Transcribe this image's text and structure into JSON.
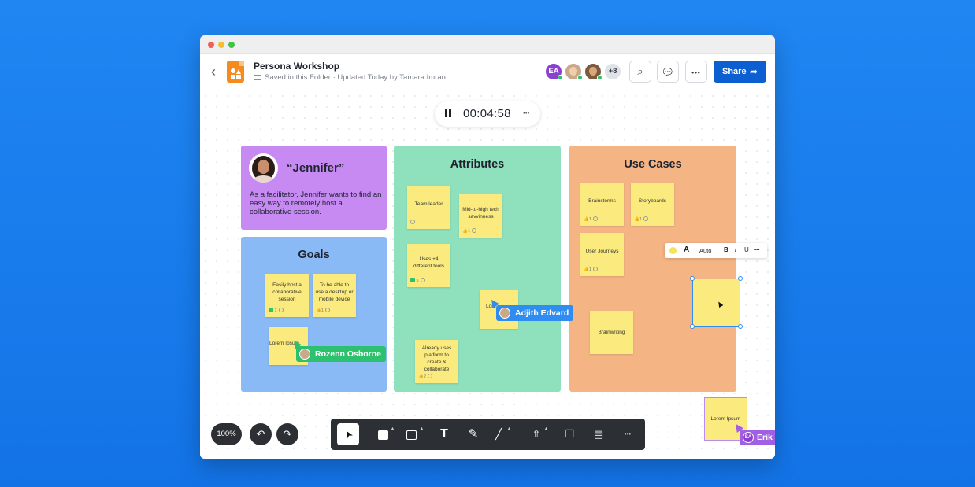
{
  "window": {
    "back_icon": "chevron-left-icon",
    "doc_title": "Persona Workshop",
    "doc_location": "Saved in this Folder",
    "doc_separator": "·",
    "doc_updated": "Updated Today by Tamara Imran"
  },
  "collaborators": {
    "first_initials": "EA",
    "more_count": "+8"
  },
  "header_buttons": {
    "search_icon": "⌕",
    "comment_icon": "💬",
    "more_icon": "•••",
    "share_label": "Share",
    "share_icon": "➦"
  },
  "timer": {
    "time": "00:04:58",
    "more": "•••"
  },
  "persona": {
    "name": "“Jennifer”",
    "description": "As a facilitator, Jennifer wants to find an easy way to remotely host a collaborative session."
  },
  "goals": {
    "title": "Goals",
    "stickies": [
      {
        "text": "Easily host a collaborative session",
        "meta": "1"
      },
      {
        "text": "To be able to use a desktop or mobile device",
        "meta": "1"
      },
      {
        "text": "Lorem Ipsum",
        "meta": ""
      }
    ]
  },
  "attributes": {
    "title": "Attributes",
    "stickies": [
      {
        "text": "Team leader",
        "meta": ""
      },
      {
        "text": "Mid-to-high tech savvinness",
        "meta": "1"
      },
      {
        "text": "Uses +4 different tools",
        "meta": "5"
      },
      {
        "text": "Lore",
        "meta": ""
      },
      {
        "text": "Already uses platform to create & collaborate",
        "meta": "2"
      }
    ]
  },
  "use_cases": {
    "title": "Use Cases",
    "stickies": [
      {
        "text": "Brainstorms",
        "meta": "1"
      },
      {
        "text": "Storyboards",
        "meta": "1"
      },
      {
        "text": "User Journeys",
        "meta": "1"
      },
      {
        "text": "Brainwriting",
        "meta": ""
      }
    ]
  },
  "cursors": {
    "rozenn": "Rozenn Osborne",
    "adjith": "Adjith Edvard",
    "erik": "Erik",
    "erik_initials": "EA"
  },
  "text_toolbar": {
    "font_icon": "A",
    "auto": "Auto",
    "bold": "B",
    "italic": "i",
    "underline": "U",
    "more": "•••"
  },
  "erik_sticky": "Lorem Ipsum",
  "bottom": {
    "zoom": "100%",
    "undo_icon": "↶",
    "redo_icon": "↷",
    "tools": {
      "select": "➤",
      "text": "T",
      "pen": "✎",
      "line": "╱",
      "upload": "⇧",
      "comments": "❐",
      "layout": "▤",
      "more": "•••"
    }
  },
  "colors": {
    "persona": "#c68af2",
    "goals": "#89baf6",
    "attributes": "#8fe0bc",
    "use_cases": "#f4b484",
    "sticky": "#fbeb7e",
    "share": "#0b5fd1"
  }
}
